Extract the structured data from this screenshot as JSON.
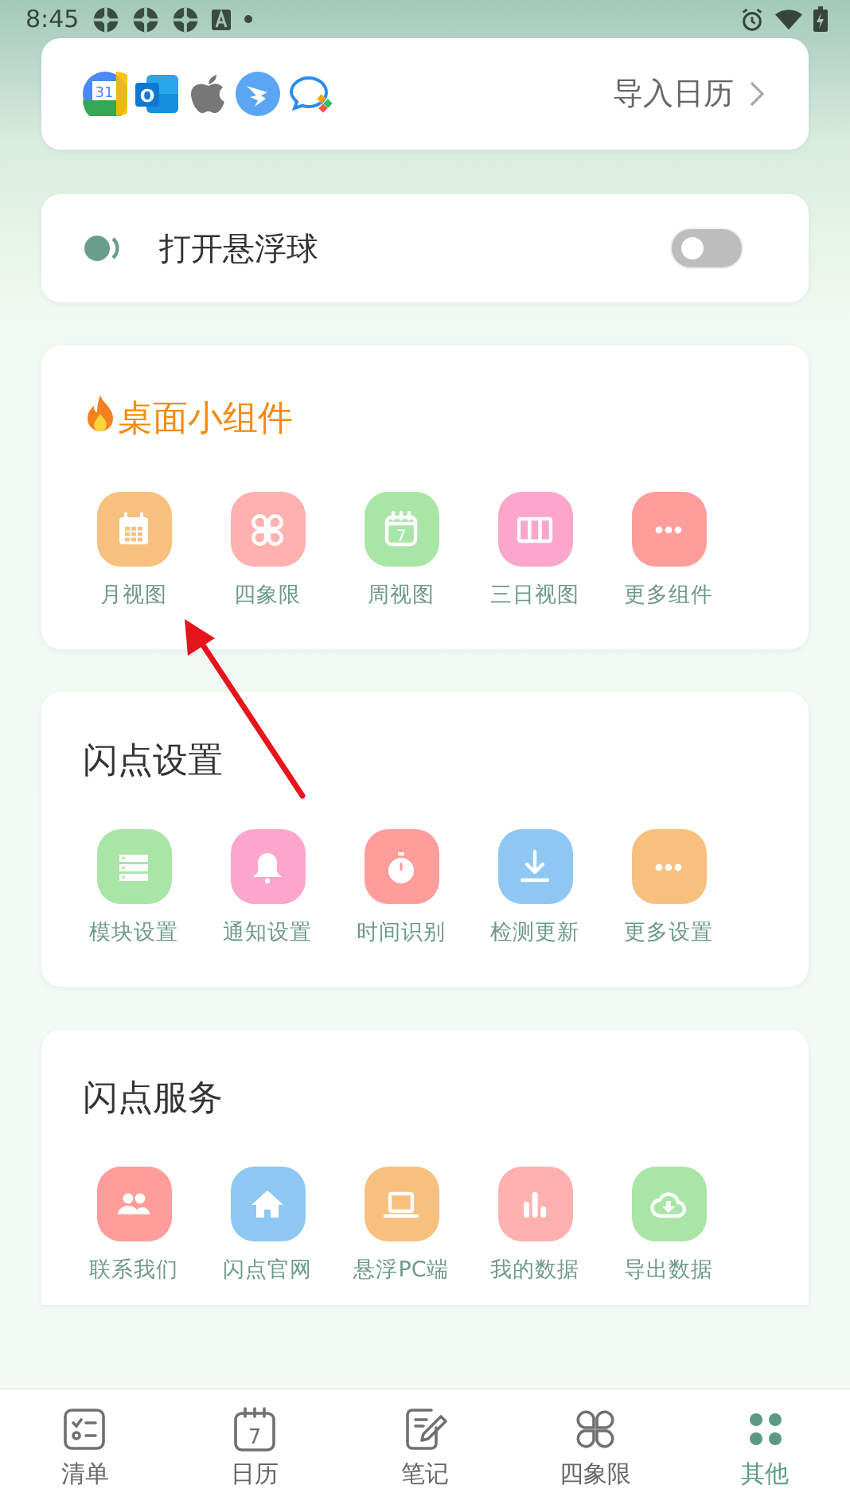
{
  "status_bar": {
    "time": "8:45",
    "notification_icons": [
      {
        "kind": "app"
      },
      {
        "kind": "app"
      },
      {
        "kind": "app"
      },
      {
        "kind": "keyboard"
      },
      {
        "kind": "dot"
      }
    ]
  },
  "import_calendar": {
    "sources": [
      {
        "kind": "google",
        "text": "31"
      },
      {
        "kind": "outlook",
        "text": "O"
      },
      {
        "kind": "apple"
      },
      {
        "kind": "dingtalk"
      },
      {
        "kind": "chat"
      }
    ],
    "label": "导入日历"
  },
  "floating_ball": {
    "label": "打开悬浮球",
    "on": false
  },
  "sections": [
    {
      "title": "桌面小组件",
      "flame": true,
      "items": [
        {
          "label": "月视图",
          "color": "#f7c07e"
        },
        {
          "label": "四象限",
          "color": "#ffb1b0"
        },
        {
          "label": "周视图",
          "color": "#aae5a8",
          "icon_text": "7"
        },
        {
          "label": "三日视图",
          "color": "#fca6cc"
        },
        {
          "label": "更多组件",
          "color": "#ff9d9b"
        }
      ]
    },
    {
      "title": "闪点设置",
      "flame": false,
      "items": [
        {
          "label": "模块设置",
          "color": "#aae5a8"
        },
        {
          "label": "通知设置",
          "color": "#fca6cc"
        },
        {
          "label": "时间识别",
          "color": "#ff9d9b"
        },
        {
          "label": "检测更新",
          "color": "#8ec8f2"
        },
        {
          "label": "更多设置",
          "color": "#f7c07e"
        }
      ]
    },
    {
      "title": "闪点服务",
      "flame": false,
      "items": [
        {
          "label": "联系我们",
          "color": "#ff9d9b"
        },
        {
          "label": "闪点官网",
          "color": "#8ec8f2"
        },
        {
          "label": "悬浮PC端",
          "color": "#f7c07e"
        },
        {
          "label": "我的数据",
          "color": "#ffb1b0"
        },
        {
          "label": "导出数据",
          "color": "#aae5a8"
        }
      ]
    }
  ],
  "bottom_nav": [
    {
      "label": "清单",
      "selected": false
    },
    {
      "label": "日历",
      "selected": false,
      "icon_text": "7"
    },
    {
      "label": "笔记",
      "selected": false
    },
    {
      "label": "四象限",
      "selected": false
    },
    {
      "label": "其他",
      "selected": true
    }
  ]
}
